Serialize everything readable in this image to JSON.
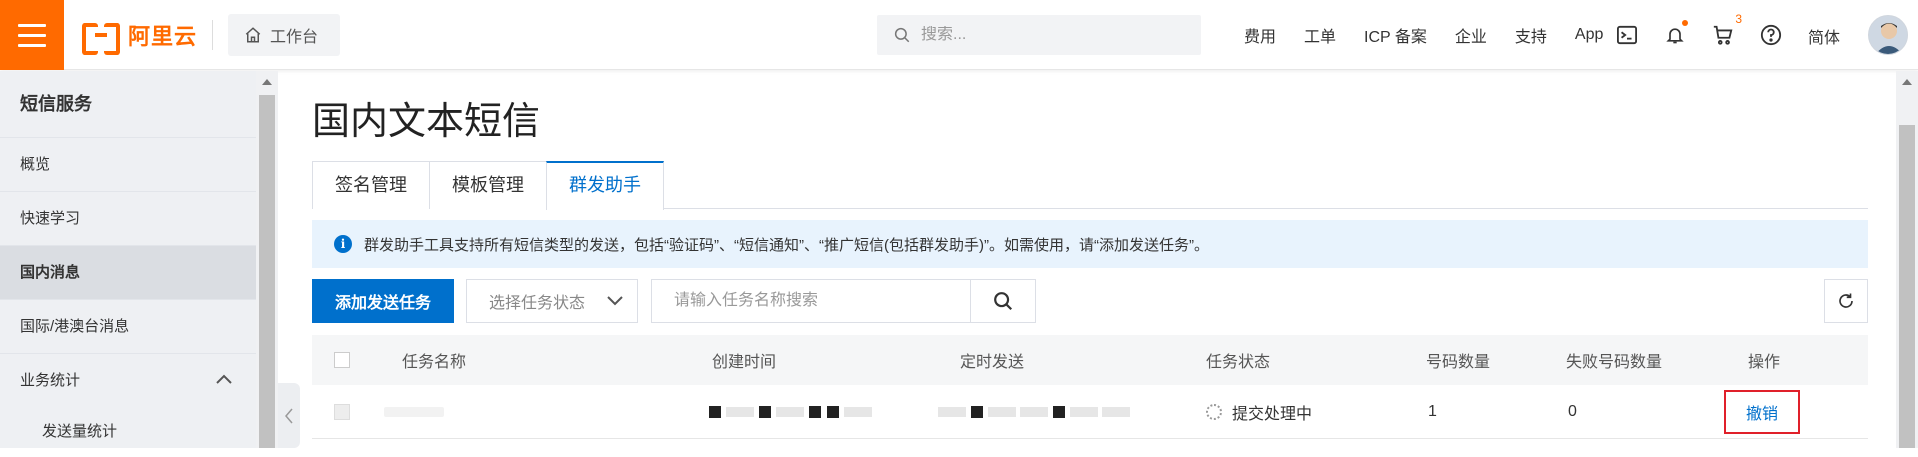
{
  "topbar": {
    "logo_text": "阿里云",
    "workbench_label": "工作台",
    "search_placeholder": "搜索...",
    "links": [
      "费用",
      "工单",
      "ICP 备案",
      "企业",
      "支持",
      "App"
    ],
    "cart_count": "3",
    "language": "简体",
    "accent_color": "#ff6a00"
  },
  "sidebar": {
    "title": "短信服务",
    "items": [
      {
        "label": "概览"
      },
      {
        "label": "快速学习"
      },
      {
        "label": "国内消息"
      },
      {
        "label": "国际/港澳台消息"
      },
      {
        "label": "业务统计"
      },
      {
        "label": "发送量统计"
      }
    ],
    "active": "国内消息"
  },
  "main": {
    "title": "国内文本短信",
    "tabs": [
      {
        "label": "签名管理"
      },
      {
        "label": "模板管理"
      },
      {
        "label": "群发助手"
      }
    ],
    "active_tab": "群发助手",
    "notice": "群发助手工具支持所有短信类型的发送，包括“验证码”、“短信通知”、“推广短信(包括群发助手)”。如需使用，请“添加发送任务”。",
    "add_task_label": "添加发送任务",
    "status_select_placeholder": "选择任务状态",
    "task_search_placeholder": "请输入任务名称搜索",
    "primary_color": "#0070cc"
  },
  "table": {
    "columns": [
      "任务名称",
      "创建时间",
      "定时发送",
      "任务状态",
      "号码数量",
      "失败号码数量",
      "操作"
    ],
    "rows": [
      {
        "status": "提交处理中",
        "number_count": "1",
        "failed_count": "0",
        "action": "撤销"
      }
    ]
  }
}
